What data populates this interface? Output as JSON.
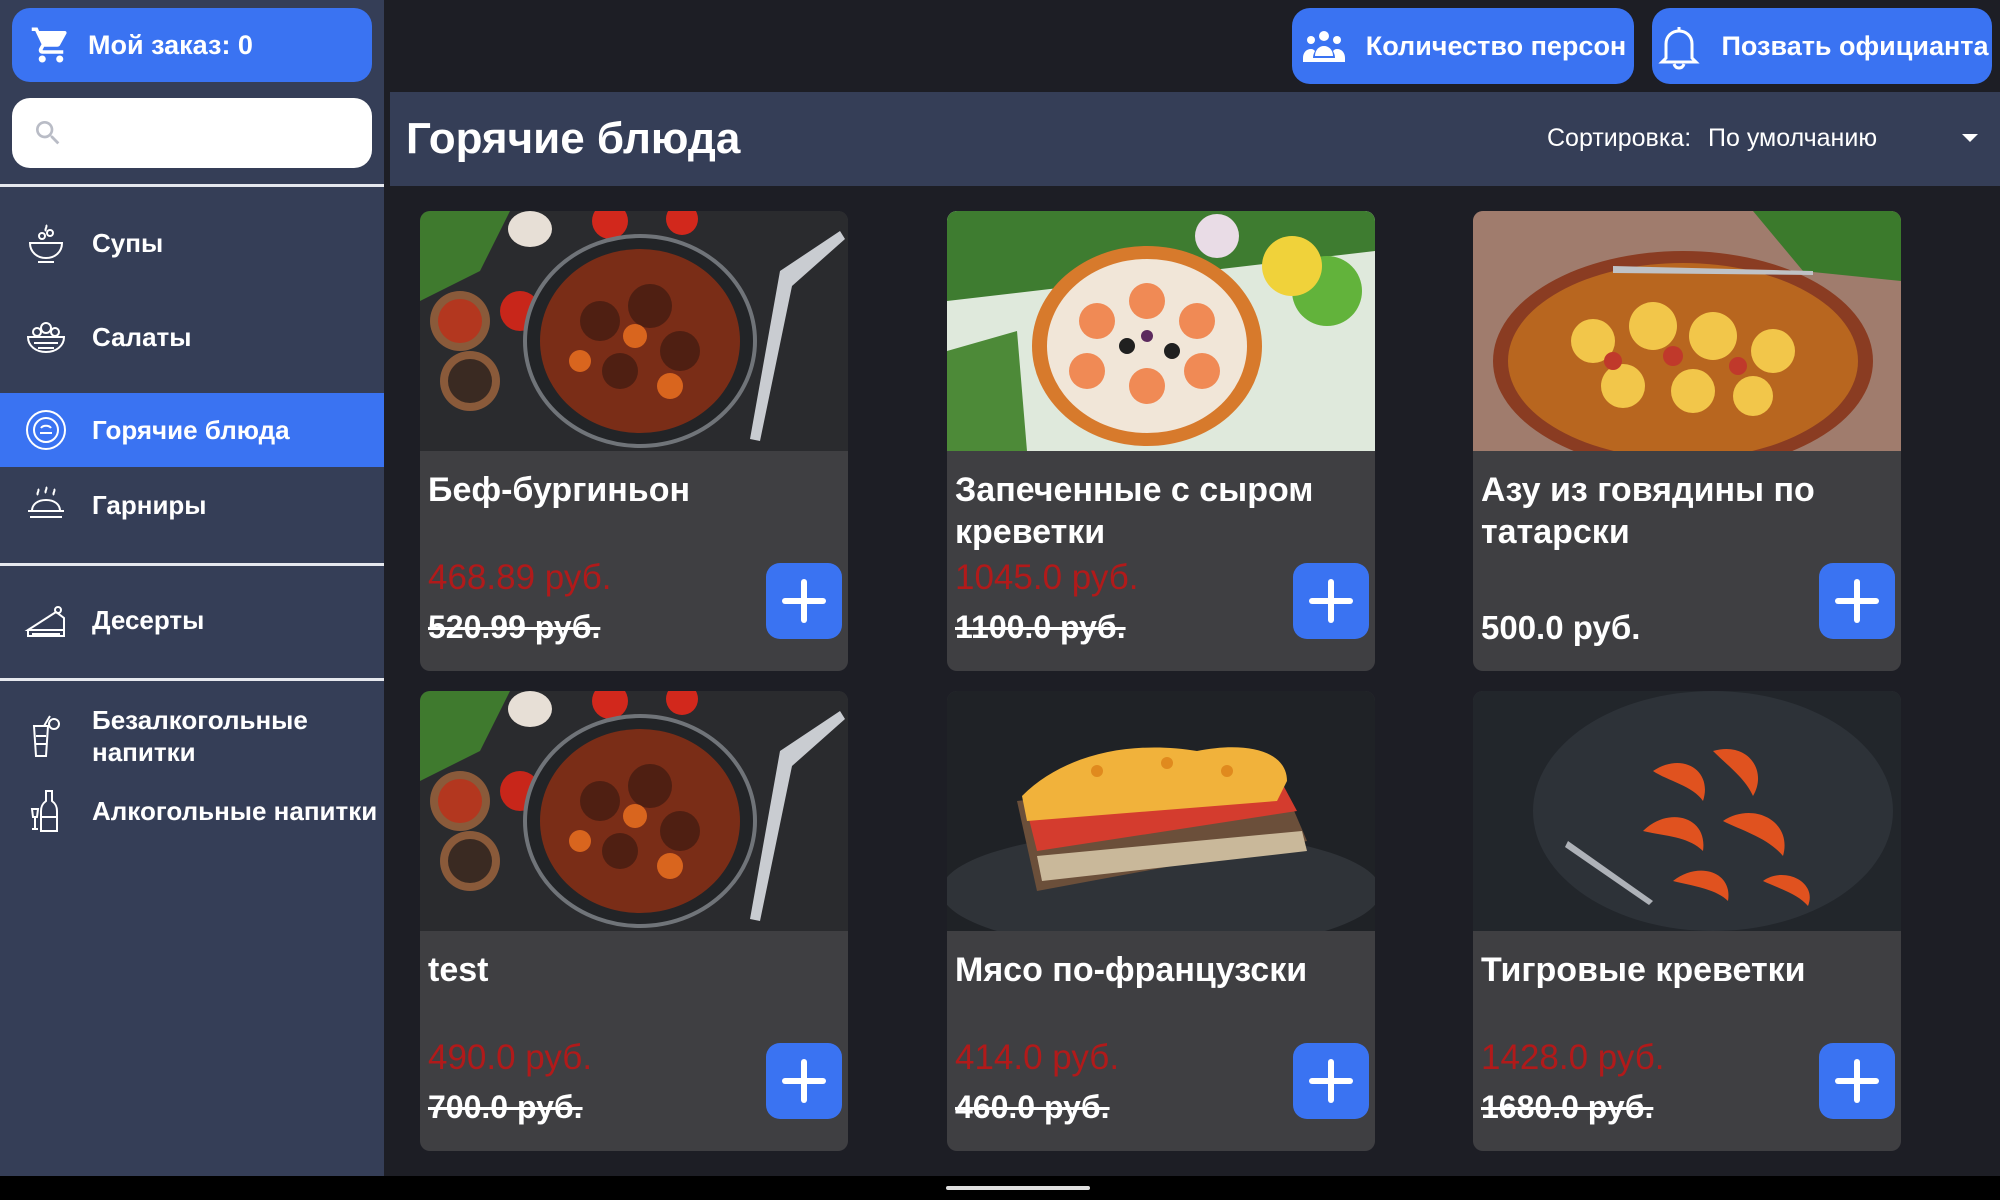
{
  "order_button": {
    "label": "Мой заказ: 0",
    "icon": "cart-icon"
  },
  "search": {
    "value": "",
    "placeholder": "",
    "icon": "search-icon"
  },
  "sidebar": {
    "items": [
      {
        "label": "Супы",
        "icon": "soup-icon",
        "active": false
      },
      {
        "label": "Салаты",
        "icon": "salad-icon",
        "active": false
      },
      {
        "label": "Горячие блюда",
        "icon": "hot-dish-icon",
        "active": true
      },
      {
        "label": "Гарниры",
        "icon": "side-dish-icon",
        "active": false
      },
      {
        "label": "Десерты",
        "icon": "cake-icon",
        "active": false
      },
      {
        "label": "Безалкогольные напитки",
        "icon": "soft-drink-icon",
        "active": false
      },
      {
        "label": "Алкогольные напитки",
        "icon": "wine-bottle-icon",
        "active": false
      }
    ]
  },
  "topbar": {
    "persons_label": "Количество персон",
    "waiter_label": "Позвать официанта"
  },
  "category": {
    "title": "Горячие блюда",
    "sort_label": "Сортировка:",
    "sort_value": "По умолчанию"
  },
  "products": [
    {
      "name": "Беф-бургиньон",
      "price_new": "468.89 руб.",
      "price_old": "520.99 руб.",
      "photo": "beef-stew"
    },
    {
      "name": "Запеченные с сыром креветки",
      "price_new": "1045.0 руб.",
      "price_old": "1100.0 руб.",
      "photo": "shrimp-salad"
    },
    {
      "name": "Азу из говядины по татарски",
      "price": "500.0 руб.",
      "photo": "azu-plate"
    },
    {
      "name": "test",
      "price_new": "490.0 руб.",
      "price_old": "700.0 руб.",
      "photo": "beef-stew"
    },
    {
      "name": "Мясо по-французски",
      "price_new": "414.0 руб.",
      "price_old": "460.0 руб.",
      "photo": "french-meat"
    },
    {
      "name": "Тигровые креветки",
      "price_new": "1428.0 руб.",
      "price_old": "1680.0 руб.",
      "photo": "tiger-prawns"
    }
  ],
  "colors": {
    "accent": "#3a73f2",
    "sidebar": "#353e57",
    "card": "#3f3f42",
    "background": "#1d1e25",
    "discount_price": "#b11a1a"
  }
}
